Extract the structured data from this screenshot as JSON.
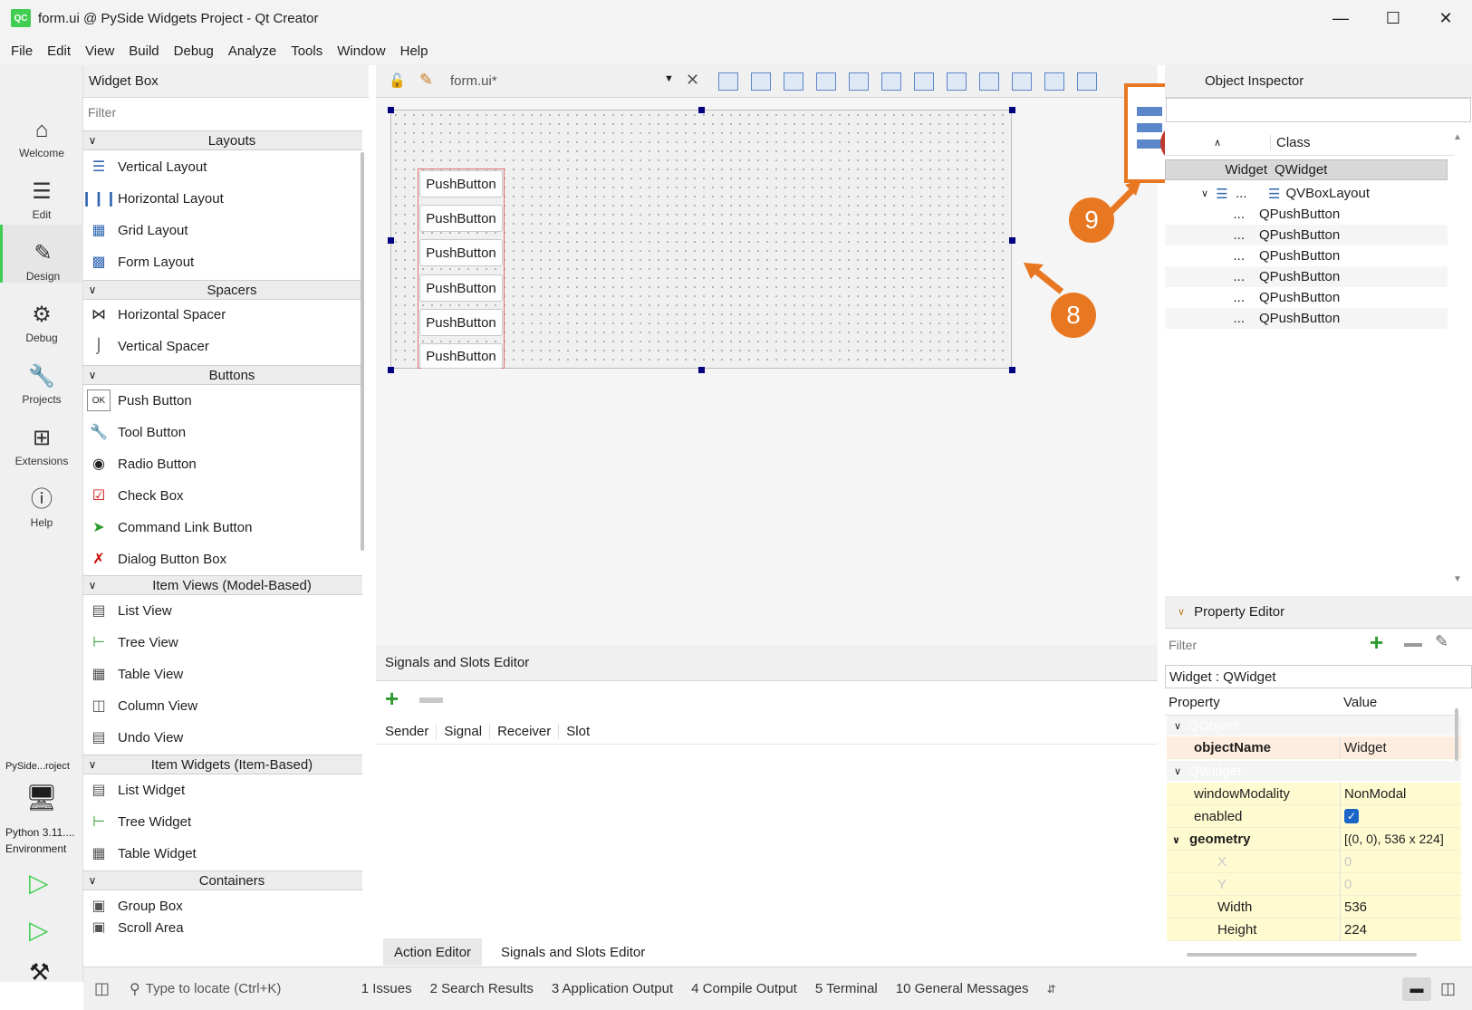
{
  "window": {
    "title": "form.ui @ PySide Widgets Project - Qt Creator",
    "logo": "QC"
  },
  "menu": [
    "File",
    "Edit",
    "View",
    "Build",
    "Debug",
    "Analyze",
    "Tools",
    "Window",
    "Help"
  ],
  "modes": [
    {
      "label": "Welcome",
      "icon": "home-icon"
    },
    {
      "label": "Edit",
      "icon": "edit-icon"
    },
    {
      "label": "Design",
      "icon": "design-icon"
    },
    {
      "label": "Debug",
      "icon": "bug-icon"
    },
    {
      "label": "Projects",
      "icon": "wrench-icon"
    },
    {
      "label": "Extensions",
      "icon": "extensions-icon"
    },
    {
      "label": "Help",
      "icon": "help-icon"
    }
  ],
  "kit": {
    "project": "PySide...roject",
    "env1": "Python 3.11....",
    "env2": "Environment"
  },
  "widget_box": {
    "title": "Widget Box",
    "filter_placeholder": "Filter",
    "categories": [
      {
        "name": "Layouts",
        "items": [
          "Vertical Layout",
          "Horizontal Layout",
          "Grid Layout",
          "Form Layout"
        ]
      },
      {
        "name": "Spacers",
        "items": [
          "Horizontal Spacer",
          "Vertical Spacer"
        ]
      },
      {
        "name": "Buttons",
        "items": [
          "Push Button",
          "Tool Button",
          "Radio Button",
          "Check Box",
          "Command Link Button",
          "Dialog Button Box"
        ]
      },
      {
        "name": "Item Views (Model-Based)",
        "items": [
          "List View",
          "Tree View",
          "Table View",
          "Column View",
          "Undo View"
        ]
      },
      {
        "name": "Item Widgets (Item-Based)",
        "items": [
          "List Widget",
          "Tree Widget",
          "Table Widget"
        ]
      },
      {
        "name": "Containers",
        "items": [
          "Group Box",
          "Scroll Area"
        ]
      }
    ]
  },
  "editor": {
    "file": "form.ui*"
  },
  "form": {
    "buttons": [
      "PushButton",
      "PushButton",
      "PushButton",
      "PushButton",
      "PushButton",
      "PushButton"
    ]
  },
  "callouts": {
    "a": "8",
    "b": "9"
  },
  "signals": {
    "title": "Signals and Slots Editor",
    "columns": [
      "Sender",
      "Signal",
      "Receiver",
      "Slot"
    ],
    "tabs": [
      "Action Editor",
      "Signals and Slots Editor"
    ]
  },
  "object_inspector": {
    "title": "Object Inspector",
    "col_class": "Class",
    "rows": [
      {
        "object": "Widget",
        "class": "QWidget"
      },
      {
        "object": "...",
        "class": "QVBoxLayout"
      },
      {
        "object": "...",
        "class": "QPushButton"
      },
      {
        "object": "...",
        "class": "QPushButton"
      },
      {
        "object": "...",
        "class": "QPushButton"
      },
      {
        "object": "...",
        "class": "QPushButton"
      },
      {
        "object": "...",
        "class": "QPushButton"
      },
      {
        "object": "...",
        "class": "QPushButton"
      }
    ]
  },
  "property_editor": {
    "title": "Property Editor",
    "filter_placeholder": "Filter",
    "context": "Widget : QWidget",
    "col_property": "Property",
    "col_value": "Value",
    "sections": {
      "qobject": "QObject",
      "qwidget": "QWidget"
    },
    "rows": [
      {
        "name": "objectName",
        "value": "Widget"
      },
      {
        "name": "windowModality",
        "value": "NonModal"
      },
      {
        "name": "enabled",
        "value": ""
      },
      {
        "name": "geometry",
        "value": "[(0, 0), 536 x 224]"
      },
      {
        "name": "X",
        "value": "0"
      },
      {
        "name": "Y",
        "value": "0"
      },
      {
        "name": "Width",
        "value": "536"
      },
      {
        "name": "Height",
        "value": "224"
      }
    ]
  },
  "status": {
    "locate_placeholder": "Type to locate (Ctrl+K)",
    "panes": [
      "1  Issues",
      "2  Search Results",
      "3  Application Output",
      "4  Compile Output",
      "5  Terminal",
      "10  General Messages"
    ]
  },
  "colors": {
    "accent": "#41cd52",
    "callout": "#e87722",
    "selection": "#000080"
  }
}
